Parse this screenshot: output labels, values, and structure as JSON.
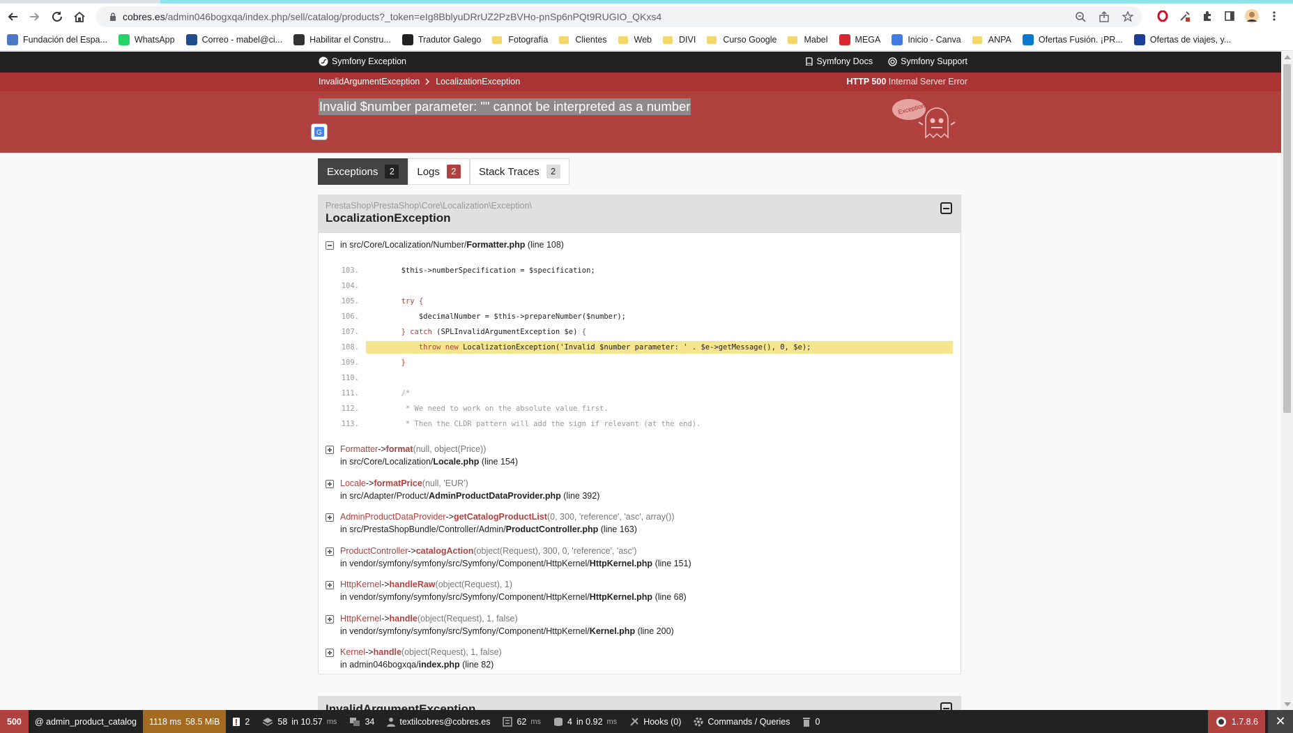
{
  "browser": {
    "url_host": "cobres.es",
    "url_path": "/admin046bogxqa/index.php/sell/catalog/products?_token=eIg8BblyuDRrUZ2PzBVHo-pnSp6nPQt9RUGIO_QKxs4",
    "bookmarks": [
      {
        "label": "Fundación del Espa...",
        "icon": "globe-icon",
        "color": "#4a78c2"
      },
      {
        "label": "WhatsApp",
        "icon": "whatsapp-icon",
        "color": "#25d366"
      },
      {
        "label": "Correo - mabel@ci...",
        "icon": "mail-icon",
        "color": "#1f4e8c"
      },
      {
        "label": "Habilitar el Constru...",
        "icon": "grid-icon",
        "color": "#333333"
      },
      {
        "label": "Tradutor Galego",
        "icon": "translate-icon",
        "color": "#222222"
      },
      {
        "label": "Fotografía",
        "icon": "folder-icon"
      },
      {
        "label": "Clientes",
        "icon": "folder-icon"
      },
      {
        "label": "Web",
        "icon": "folder-icon"
      },
      {
        "label": "DIVI",
        "icon": "folder-icon"
      },
      {
        "label": "Curso Google",
        "icon": "folder-icon"
      },
      {
        "label": "Mabel",
        "icon": "folder-icon"
      },
      {
        "label": "MEGA",
        "icon": "mega-icon",
        "color": "#d9272e"
      },
      {
        "label": "Inicio - Canva",
        "icon": "canva-icon",
        "color": "#3f7be0"
      },
      {
        "label": "ANPA",
        "icon": "folder-icon"
      },
      {
        "label": "Ofertas Fusión. ¡PR...",
        "icon": "movistar-icon",
        "color": "#0b78d0"
      },
      {
        "label": "Ofertas de viajes, y...",
        "icon": "travel-icon",
        "color": "#1b3f95"
      }
    ]
  },
  "symfony": {
    "header_title": "Symfony Exception",
    "docs_link": "Symfony Docs",
    "support_link": "Symfony Support",
    "crumb_1": "InvalidArgumentException",
    "crumb_2": "LocalizationException",
    "status_code": "HTTP 500",
    "status_text": "Internal Server Error",
    "message": "Invalid $number parameter: \"\" cannot be interpreted as a number",
    "ghost_label": "Exception!"
  },
  "tabs": [
    {
      "label": "Exceptions",
      "count": "2"
    },
    {
      "label": "Logs",
      "count": "2"
    },
    {
      "label": "Stack Traces",
      "count": "2"
    }
  ],
  "exception": {
    "namespace": "PrestaShop\\PrestaShop\\Core\\Localization\\Exception\\",
    "class": "LocalizationException",
    "file_prefix": "in src/Core/Localization/Number/",
    "file_name": "Formatter.php",
    "file_line": "(line 108)",
    "code_lines": [
      {
        "num": "103.",
        "code": "        $this->numberSpecification = $specification;"
      },
      {
        "num": "104.",
        "code": ""
      },
      {
        "num": "105.",
        "code": "        try {"
      },
      {
        "num": "106.",
        "code": "            $decimalNumber = $this->prepareNumber($number);"
      },
      {
        "num": "107.",
        "code": "        } catch (SPLInvalidArgumentException $e) {"
      },
      {
        "num": "108.",
        "code": "            throw new LocalizationException('Invalid $number parameter: ' . $e->getMessage(), 0, $e);"
      },
      {
        "num": "109.",
        "code": "        }"
      },
      {
        "num": "110.",
        "code": ""
      },
      {
        "num": "111.",
        "code": "        /*"
      },
      {
        "num": "112.",
        "code": "         * We need to work on the absolute value first."
      },
      {
        "num": "113.",
        "code": "         * Then the CLDR pattern will add the sign if relevant (at the end)."
      }
    ],
    "frames": [
      {
        "cls": "Formatter",
        "fn": "format",
        "args": "(null, object(Price))",
        "path": "in src/Core/Localization/",
        "file": "Locale.php",
        "line": "(line 154)"
      },
      {
        "cls": "Locale",
        "fn": "formatPrice",
        "args": "(null, 'EUR')",
        "path": "in src/Adapter/Product/",
        "file": "AdminProductDataProvider.php",
        "line": "(line 392)"
      },
      {
        "cls": "AdminProductDataProvider",
        "fn": "getCatalogProductList",
        "args": "(0, 300, 'reference', 'asc', array())",
        "path": "in src/PrestaShopBundle/Controller/Admin/",
        "file": "ProductController.php",
        "line": "(line 163)"
      },
      {
        "cls": "ProductController",
        "fn": "catalogAction",
        "args": "(object(Request), 300, 0, 'reference', 'asc')",
        "path": "in vendor/symfony/symfony/src/Symfony/Component/HttpKernel/",
        "file": "HttpKernel.php",
        "line": "(line 151)"
      },
      {
        "cls": "HttpKernel",
        "fn": "handleRaw",
        "args": "(object(Request), 1)",
        "path": "in vendor/symfony/symfony/src/Symfony/Component/HttpKernel/",
        "file": "HttpKernel.php",
        "line": "(line 68)"
      },
      {
        "cls": "HttpKernel",
        "fn": "handle",
        "args": "(object(Request), 1, false)",
        "path": "in vendor/symfony/symfony/src/Symfony/Component/HttpKernel/",
        "file": "Kernel.php",
        "line": "(line 200)"
      },
      {
        "cls": "Kernel",
        "fn": "handle",
        "args": "(object(Request), 1, false)",
        "path": "in admin046bogxqa/",
        "file": "index.php",
        "line": "(line 82)"
      }
    ]
  },
  "exception2": {
    "class": "InvalidArgumentException"
  },
  "profiler": {
    "status": "500",
    "route": "@ admin_product_catalog",
    "time": "1118 ms",
    "memory": "58.5 MiB",
    "errors": "2",
    "cache": "58",
    "cache_in": "in 10.57",
    "cache_unit": "ms",
    "translations": "34",
    "user": "textilcobres@cobres.es",
    "db_time": "62",
    "db_unit": "ms",
    "queries": "4",
    "queries_in": "in 0.92",
    "queries_unit": "ms",
    "hooks": "Hooks (0)",
    "commands": "Commands / Queries",
    "misc": "0",
    "version": "1.7.8.6"
  }
}
